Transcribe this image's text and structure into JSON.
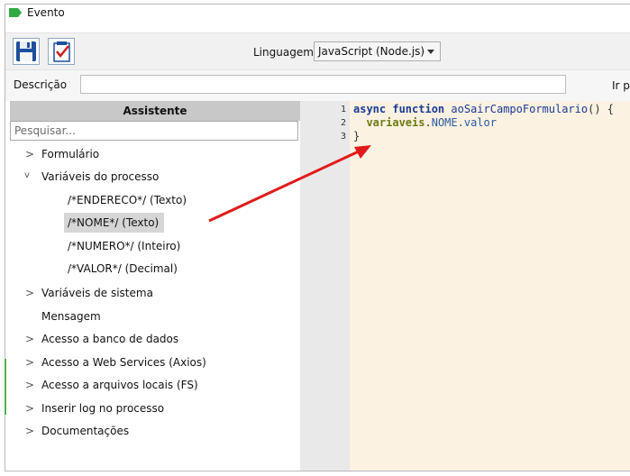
{
  "window": {
    "title": "Evento"
  },
  "toolbar": {
    "save_icon": "floppy-disk-icon",
    "check_icon": "checklist-icon",
    "language_label": "Linguagem",
    "language_value": "JavaScript (Node.js)"
  },
  "description": {
    "label": "Descrição",
    "value": "",
    "truncated_label": "Ir p"
  },
  "assistant": {
    "header": "Assistente",
    "search_placeholder": "Pesquisar...",
    "tree": [
      {
        "label": "Formulário",
        "chevron": ">"
      },
      {
        "label": "Variáveis do processo",
        "chevron": "v"
      },
      {
        "label": "/*ENDERECO*/ (Texto)"
      },
      {
        "label": "/*NOME*/ (Texto)"
      },
      {
        "label": "/*NUMERO*/ (Inteiro)"
      },
      {
        "label": "/*VALOR*/ (Decimal)"
      },
      {
        "label": "Variáveis de sistema",
        "chevron": ">"
      },
      {
        "label": "Mensagem"
      },
      {
        "label": "Acesso a banco de dados",
        "chevron": ">"
      },
      {
        "label": "Acesso a Web Services (Axios)",
        "chevron": ">"
      },
      {
        "label": "Acesso a arquivos locais (FS)",
        "chevron": ">"
      },
      {
        "label": "Inserir log no processo",
        "chevron": ">"
      },
      {
        "label": "Documentações",
        "chevron": ">"
      }
    ]
  },
  "editor": {
    "line_numbers": [
      "1",
      "2",
      "3"
    ],
    "line1": {
      "kw1": "async",
      "kw2": "function",
      "name": "aoSairCampoFormulario",
      "rest": "() {"
    },
    "line2": {
      "var": "variaveis",
      "dot": ".",
      "prop": "NOME.valor"
    },
    "line3": {
      "text": "}"
    }
  },
  "colors": {
    "accent_green": "#33a846",
    "editor_bg": "#fbf2e2",
    "arrow": "#e11b1b"
  }
}
